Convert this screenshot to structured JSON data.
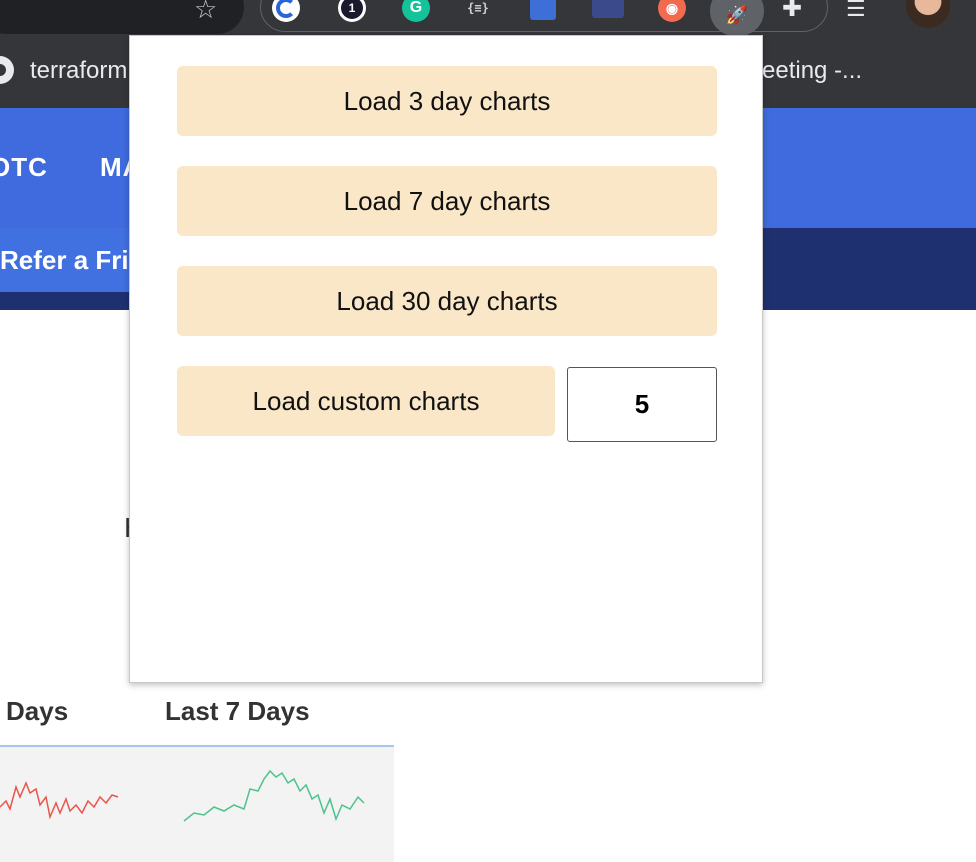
{
  "browser": {
    "bookmarks": [
      "terraform",
      "eeting -..."
    ],
    "extensions": {
      "onepassword_badge": "1",
      "grammarly_letter": "G",
      "json_viewer_label": "{≡}"
    }
  },
  "site": {
    "nav": [
      "OTC",
      "MA"
    ],
    "refer_label": "Refer a Frie",
    "partial_heading": "H",
    "columns": [
      "Days",
      "Last 7 Days"
    ]
  },
  "popup": {
    "btn_3day": "Load 3 day charts",
    "btn_7day": "Load 7 day charts",
    "btn_30day": "Load 30 day charts",
    "btn_custom": "Load custom charts",
    "custom_days_value": "5"
  },
  "colors": {
    "popup_button_bg": "#f9e7c8",
    "nav_bg": "#3f6bde",
    "refer_bar_bg": "#1f3070",
    "spark_down": "#e8554a",
    "spark_up": "#4cc38a"
  },
  "icons": [
    "star-icon",
    "ext-password-icon",
    "ext-1password-icon",
    "ext-grammarly-icon",
    "ext-json-icon",
    "ext-inspector-icon",
    "ext-video-icon",
    "ext-camera-icon",
    "ext-rocket-icon",
    "puzzle-icon",
    "queue-music-icon",
    "avatar",
    "github-icon"
  ]
}
